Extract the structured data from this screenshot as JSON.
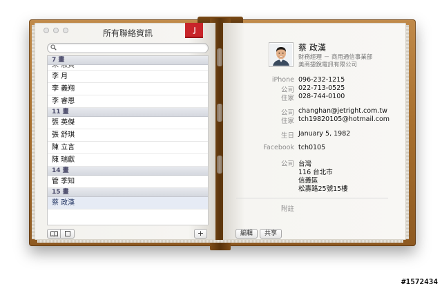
{
  "left_page": {
    "title": "所有聯絡資訊",
    "bookmark_glyph": "亅",
    "search": {
      "value": "",
      "placeholder": ""
    },
    "list": [
      {
        "type": "header",
        "text": "7 畫"
      },
      {
        "type": "clipped",
        "text": "宋 淑貞"
      },
      {
        "type": "item",
        "text": "李 月"
      },
      {
        "type": "item",
        "text": "李 義翔"
      },
      {
        "type": "item",
        "text": "李 睿恩"
      },
      {
        "type": "header",
        "text": "11 畫"
      },
      {
        "type": "item",
        "text": "張 英傑"
      },
      {
        "type": "item",
        "text": "張 舒琪"
      },
      {
        "type": "item",
        "text": "陳 立言"
      },
      {
        "type": "item",
        "text": "陳 瑞獻"
      },
      {
        "type": "header",
        "text": "14 畫"
      },
      {
        "type": "item",
        "text": "管 季知"
      },
      {
        "type": "header",
        "text": "15 畫"
      },
      {
        "type": "selected",
        "text": "蔡 政漢"
      }
    ],
    "add_button_label": "+"
  },
  "right_page": {
    "name": "蔡 政漢",
    "job_title": "財務經理 － 商用通信事業部",
    "company": "美商捷銳電訊有限公司",
    "fields": [
      {
        "label": "iPhone",
        "value": "096-232-1215"
      },
      {
        "label": "公司",
        "value": "022-713-0525"
      },
      {
        "label": "住家",
        "value": "028-744-0100"
      },
      {
        "label": "公司",
        "value": "changhan@jetright.com.tw"
      },
      {
        "label": "住家",
        "value": "tch19820105@hotmail.com"
      },
      {
        "label": "生日",
        "value": "January 5, 1982"
      },
      {
        "label": "Facebook",
        "value": "tch0105"
      }
    ],
    "address": {
      "label": "公司",
      "lines": [
        "台灣",
        "116 台北市",
        "信義區",
        "松壽路25號15樓"
      ]
    },
    "notes_label": "附註",
    "edit_button": "編輯",
    "share_button": "共享"
  },
  "watermark": "#1572434"
}
